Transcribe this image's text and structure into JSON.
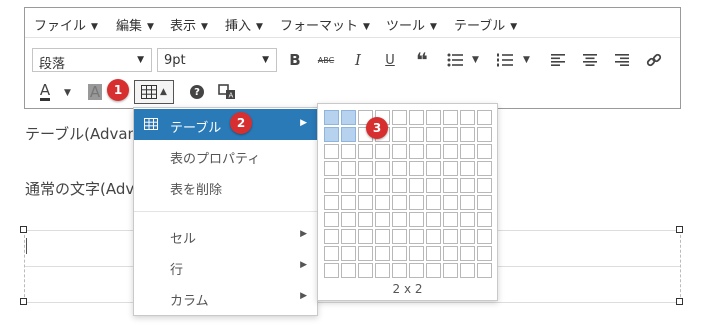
{
  "menubar": {
    "items": [
      {
        "label": "ファイル"
      },
      {
        "label": "編集"
      },
      {
        "label": "表示"
      },
      {
        "label": "挿入"
      },
      {
        "label": "フォーマット"
      },
      {
        "label": "ツール"
      },
      {
        "label": "テーブル"
      }
    ]
  },
  "toolbar": {
    "format_select": "段落",
    "size_select": "9pt",
    "bold": "B",
    "strike": "ABC",
    "italic": "I",
    "underline": "U",
    "quote": "❝",
    "text_color": "A",
    "bg_color": "A",
    "help": "?"
  },
  "content": {
    "line1": "テーブル(Advan",
    "line2": "通常の文字(Adv"
  },
  "dropdown": {
    "items": [
      {
        "label": "テーブル",
        "has_submenu": true,
        "active": true
      },
      {
        "label": "表のプロパティ",
        "has_submenu": false
      },
      {
        "label": "表を削除",
        "has_submenu": false
      },
      {
        "label": "セル",
        "has_submenu": true
      },
      {
        "label": "行",
        "has_submenu": true
      },
      {
        "label": "カラム",
        "has_submenu": true
      }
    ]
  },
  "grid_picker": {
    "rows": 10,
    "cols": 10,
    "selected_rows": 2,
    "selected_cols": 2,
    "size_label": "2 x 2"
  },
  "markers": [
    "1",
    "2",
    "3"
  ],
  "colors": {
    "accent": "#2a7ab8",
    "marker": "#d72f2f",
    "grid_selected": "#b6d2ef"
  }
}
